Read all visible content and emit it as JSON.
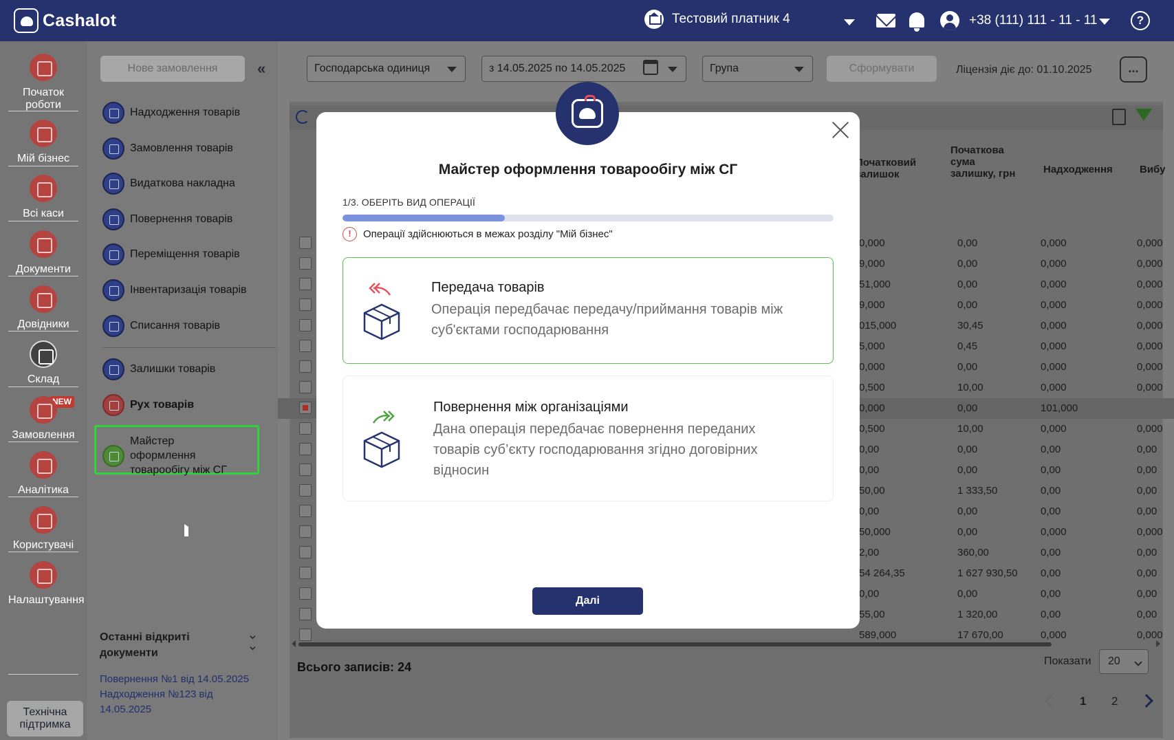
{
  "app": {
    "logo_text": "Cashalot"
  },
  "header": {
    "payer": "Тестовий платник 4",
    "phone": "+38 (111) 111 - 11 - 11",
    "help": "?"
  },
  "rail": {
    "items": [
      {
        "label": "Початок роботи",
        "icon": "start-icon"
      },
      {
        "label": "Мій бізнес",
        "icon": "business-icon"
      },
      {
        "label": "Всі каси",
        "icon": "cash-registers-icon"
      },
      {
        "label": "Документи",
        "icon": "documents-icon"
      },
      {
        "label": "Довідники",
        "icon": "directories-icon"
      },
      {
        "label": "Склад",
        "icon": "warehouse-icon"
      },
      {
        "label": "Замовлення",
        "icon": "orders-icon",
        "badge": "NEW"
      },
      {
        "label": "Аналітика",
        "icon": "analytics-icon"
      },
      {
        "label": "Користувачі",
        "icon": "users-icon"
      },
      {
        "label": "Налаштування",
        "icon": "settings-icon"
      }
    ],
    "support": "Технічна підтримка"
  },
  "submenu": {
    "new_order": "Нове замовлення",
    "items": [
      "Надходження товарів",
      "Замовлення товарів",
      "Видаткова накладна",
      "Повернення товарів",
      "Переміщення товарів",
      "Інвентаризація товарів",
      "Списання товарів",
      "Залишки товарів",
      "Рух товарів",
      "Майстер оформлення товарообігу між СГ"
    ],
    "recent_title": "Останні відкриті документи",
    "recent": [
      "Повернення №1 від 14.05.2025",
      "Надходження №123 від 14.05.2025"
    ]
  },
  "filters": {
    "unit": "Господарська одиниця",
    "dates": "з 14.05.2025 по 14.05.2025",
    "group": "Група",
    "form": "Сформувати",
    "license": "Ліцензія діє до: 01.10.2025",
    "more": "..."
  },
  "table": {
    "headers": [
      "Початковий залишок",
      "Початкова сума залишку, грн",
      "Надходження",
      "Вибу"
    ],
    "rows": [
      [
        "0,000",
        "0,00",
        "0,000",
        "0,000"
      ],
      [
        "9,000",
        "0,00",
        "0,000",
        "0,000"
      ],
      [
        "51,000",
        "0,00",
        "0,000",
        "0,000"
      ],
      [
        "9,000",
        "0,00",
        "0,000",
        "0,000"
      ],
      [
        "015,000",
        "30,45",
        "0,000",
        "0,000"
      ],
      [
        "5,000",
        "0,45",
        "0,000",
        "0,000"
      ],
      [
        "0,000",
        "0,00",
        "0,000",
        "0,000"
      ],
      [
        "0,500",
        "10,00",
        "0,000",
        "0,000"
      ],
      [
        "0,000",
        "0,00",
        "101,000",
        ""
      ],
      [
        "0,500",
        "10,00",
        "0,000",
        "0,000"
      ],
      [
        "0,00",
        "0,00",
        "0,00",
        "0,00"
      ],
      [
        "0,00",
        "0,00",
        "0,00",
        "0,00"
      ],
      [
        "50,00",
        "1 333,50",
        "0,00",
        "0,00"
      ],
      [
        "0,00",
        "0,00",
        "0,00",
        "0,00"
      ],
      [
        "50,000",
        "0,00",
        "0,000",
        "0,000"
      ],
      [
        "2,00",
        "360,00",
        "0,00",
        "0,00"
      ],
      [
        "54 264,35",
        "1 627 930,50",
        "0,00",
        "0,00"
      ],
      [
        "0,00",
        "0,00",
        "0,00",
        "0,00"
      ],
      [
        "55,00",
        "1 320,00",
        "0,00",
        "0,00"
      ],
      [
        "589,000",
        "17 670,00",
        "0,000",
        "0,000"
      ]
    ],
    "checked_row": 8,
    "total": "Всього записів: 24",
    "show_label": "Показати",
    "page_size": "20",
    "pages": [
      "1",
      "2"
    ],
    "current_page": "1"
  },
  "modal": {
    "title": "Майстер оформлення товарообігу між СГ",
    "step": "1/3. ОБЕРІТЬ ВИД ОПЕРАЦІЇ",
    "progress": 0.33,
    "warning": "Операції здійснюються в межах розділу \"Мій бізнес\"",
    "options": [
      {
        "title": "Передача товарів",
        "desc": "Операція передбачає передачу/приймання товарів між суб'єктами господарювання",
        "icon": "box-transfer-icon",
        "selected": true
      },
      {
        "title": "Повернення між організаціями",
        "desc": "Дана операція передбачає повернення переданих товарів суб’єкту господарювання згідно договірних відносин",
        "icon": "box-return-icon",
        "selected": false
      }
    ],
    "next": "Далі"
  },
  "colors": {
    "brand": "#25326e",
    "accent_red": "#e5505a",
    "selected_border": "#59c14a",
    "progress": "#7a93dc"
  }
}
